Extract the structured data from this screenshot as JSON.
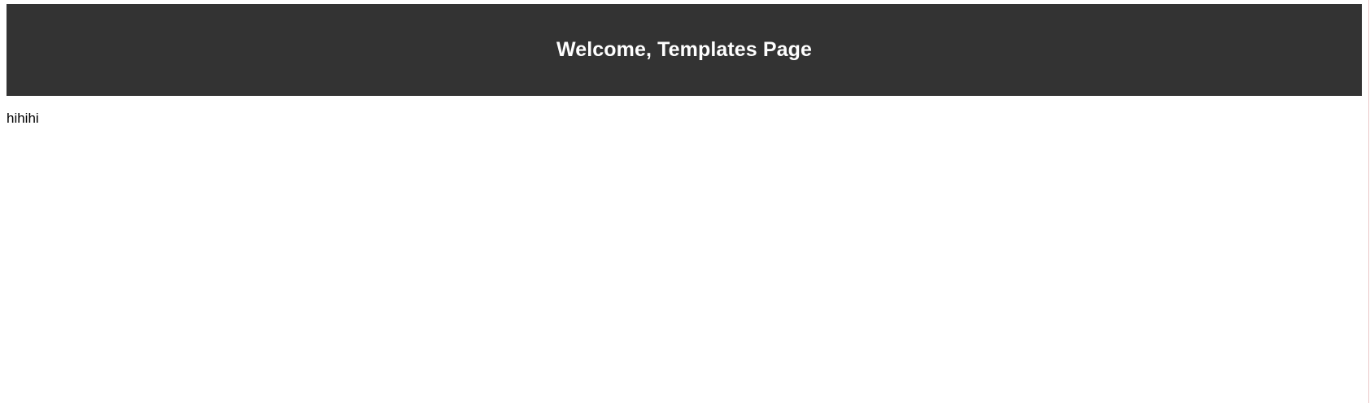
{
  "header": {
    "title": "Welcome, Templates Page",
    "background_color": "#333333",
    "text_color": "#ffffff"
  },
  "content": {
    "text": "hihihi"
  }
}
